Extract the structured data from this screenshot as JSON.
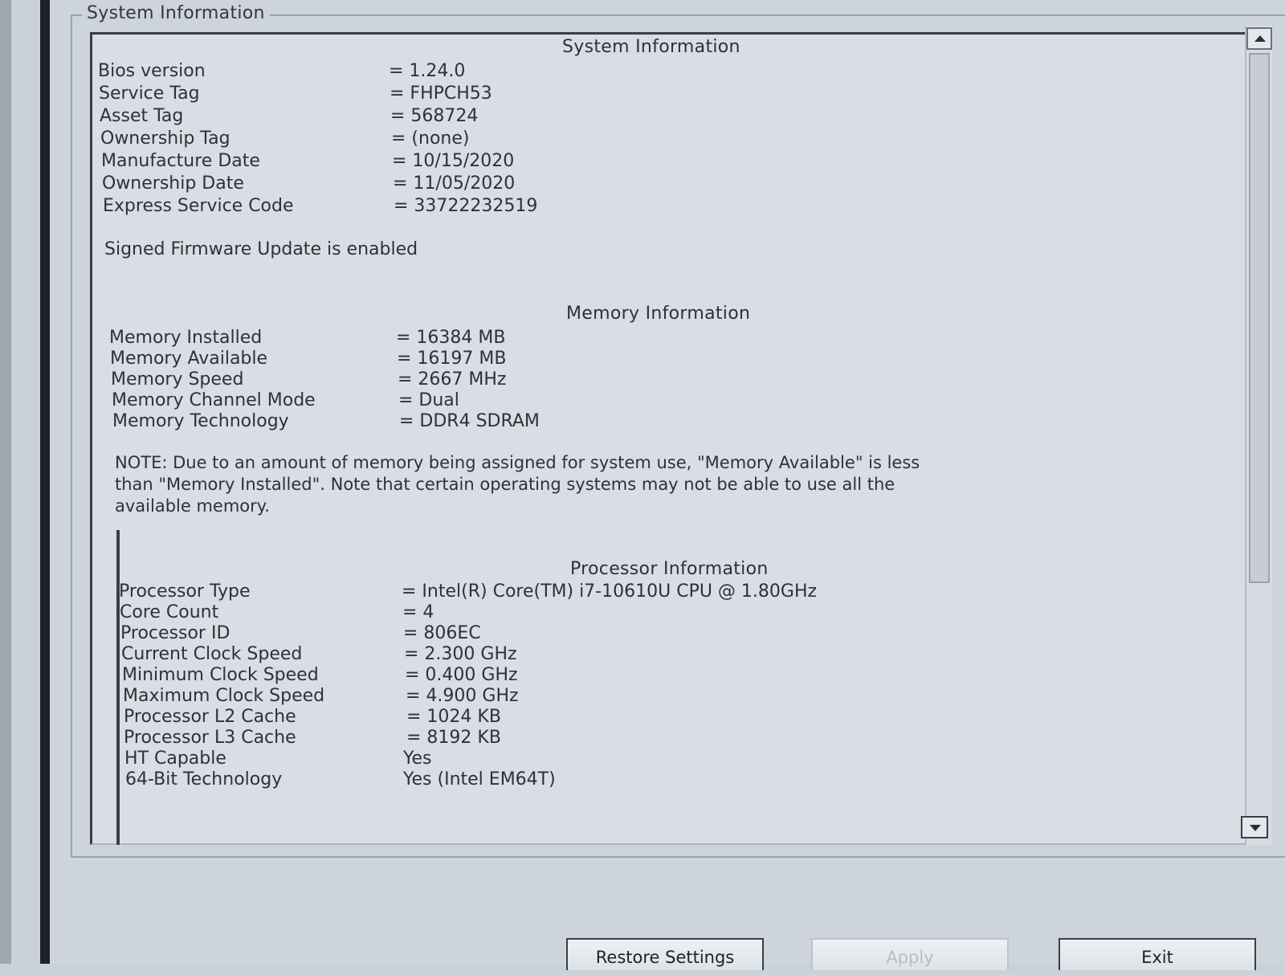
{
  "groupbox_title": "System Information",
  "system": {
    "heading": "System Information",
    "rows": [
      {
        "label": "Bios version",
        "value": "= 1.24.0"
      },
      {
        "label": "Service Tag",
        "value": "= FHPCH53"
      },
      {
        "label": "Asset Tag",
        "value": "= 568724"
      },
      {
        "label": "Ownership Tag",
        "value": "= (none)"
      },
      {
        "label": "Manufacture Date",
        "value": "= 10/15/2020"
      },
      {
        "label": "Ownership Date",
        "value": "= 11/05/2020"
      },
      {
        "label": "Express Service Code",
        "value": "= 33722232519"
      }
    ],
    "firmware_note": "Signed Firmware Update is enabled"
  },
  "memory": {
    "heading": "Memory Information",
    "rows": [
      {
        "label": "Memory Installed",
        "value": "= 16384 MB"
      },
      {
        "label": "Memory Available",
        "value": "= 16197 MB"
      },
      {
        "label": "Memory Speed",
        "value": "= 2667 MHz"
      },
      {
        "label": "Memory Channel Mode",
        "value": "= Dual"
      },
      {
        "label": "Memory Technology",
        "value": "= DDR4 SDRAM"
      }
    ],
    "note_line1": "NOTE: Due to an amount of memory being assigned for system use, \"Memory Available\" is less",
    "note_line2": "than \"Memory Installed\". Note that certain operating systems may not be able to use all the",
    "note_line3": "available memory."
  },
  "processor": {
    "heading": "Processor Information",
    "rows": [
      {
        "label": "Processor Type",
        "value": "= Intel(R) Core(TM) i7-10610U CPU @ 1.80GHz"
      },
      {
        "label": "Core Count",
        "value": "= 4"
      },
      {
        "label": "Processor ID",
        "value": "= 806EC"
      },
      {
        "label": "Current Clock Speed",
        "value": "= 2.300 GHz"
      },
      {
        "label": "Minimum Clock Speed",
        "value": "= 0.400 GHz"
      },
      {
        "label": "Maximum Clock Speed",
        "value": "= 4.900 GHz"
      },
      {
        "label": "Processor L2 Cache",
        "value": "= 1024 KB"
      },
      {
        "label": "Processor L3 Cache",
        "value": "= 8192 KB"
      },
      {
        "label": "HT Capable",
        "value": "Yes"
      },
      {
        "label": "64-Bit Technology",
        "value": "Yes (Intel EM64T)"
      }
    ]
  },
  "buttons": {
    "restore": "Restore Settings",
    "apply": "Apply",
    "exit": "Exit"
  },
  "icons": {
    "scroll_up": "scroll-up-arrow-icon",
    "scroll_down": "scroll-down-arrow-icon"
  }
}
